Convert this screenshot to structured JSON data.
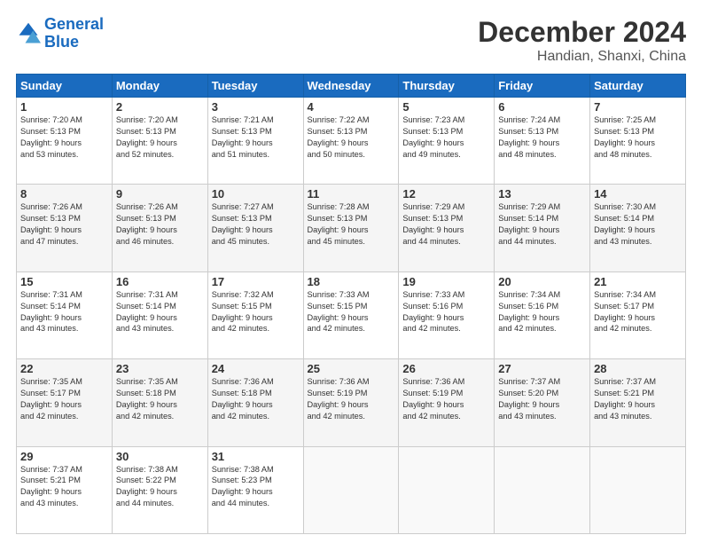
{
  "header": {
    "logo_general": "General",
    "logo_blue": "Blue",
    "main_title": "December 2024",
    "subtitle": "Handian, Shanxi, China"
  },
  "weekdays": [
    "Sunday",
    "Monday",
    "Tuesday",
    "Wednesday",
    "Thursday",
    "Friday",
    "Saturday"
  ],
  "weeks": [
    [
      {
        "day": "1",
        "info": "Sunrise: 7:20 AM\nSunset: 5:13 PM\nDaylight: 9 hours\nand 53 minutes."
      },
      {
        "day": "2",
        "info": "Sunrise: 7:20 AM\nSunset: 5:13 PM\nDaylight: 9 hours\nand 52 minutes."
      },
      {
        "day": "3",
        "info": "Sunrise: 7:21 AM\nSunset: 5:13 PM\nDaylight: 9 hours\nand 51 minutes."
      },
      {
        "day": "4",
        "info": "Sunrise: 7:22 AM\nSunset: 5:13 PM\nDaylight: 9 hours\nand 50 minutes."
      },
      {
        "day": "5",
        "info": "Sunrise: 7:23 AM\nSunset: 5:13 PM\nDaylight: 9 hours\nand 49 minutes."
      },
      {
        "day": "6",
        "info": "Sunrise: 7:24 AM\nSunset: 5:13 PM\nDaylight: 9 hours\nand 48 minutes."
      },
      {
        "day": "7",
        "info": "Sunrise: 7:25 AM\nSunset: 5:13 PM\nDaylight: 9 hours\nand 48 minutes."
      }
    ],
    [
      {
        "day": "8",
        "info": "Sunrise: 7:26 AM\nSunset: 5:13 PM\nDaylight: 9 hours\nand 47 minutes."
      },
      {
        "day": "9",
        "info": "Sunrise: 7:26 AM\nSunset: 5:13 PM\nDaylight: 9 hours\nand 46 minutes."
      },
      {
        "day": "10",
        "info": "Sunrise: 7:27 AM\nSunset: 5:13 PM\nDaylight: 9 hours\nand 45 minutes."
      },
      {
        "day": "11",
        "info": "Sunrise: 7:28 AM\nSunset: 5:13 PM\nDaylight: 9 hours\nand 45 minutes."
      },
      {
        "day": "12",
        "info": "Sunrise: 7:29 AM\nSunset: 5:13 PM\nDaylight: 9 hours\nand 44 minutes."
      },
      {
        "day": "13",
        "info": "Sunrise: 7:29 AM\nSunset: 5:14 PM\nDaylight: 9 hours\nand 44 minutes."
      },
      {
        "day": "14",
        "info": "Sunrise: 7:30 AM\nSunset: 5:14 PM\nDaylight: 9 hours\nand 43 minutes."
      }
    ],
    [
      {
        "day": "15",
        "info": "Sunrise: 7:31 AM\nSunset: 5:14 PM\nDaylight: 9 hours\nand 43 minutes."
      },
      {
        "day": "16",
        "info": "Sunrise: 7:31 AM\nSunset: 5:14 PM\nDaylight: 9 hours\nand 43 minutes."
      },
      {
        "day": "17",
        "info": "Sunrise: 7:32 AM\nSunset: 5:15 PM\nDaylight: 9 hours\nand 42 minutes."
      },
      {
        "day": "18",
        "info": "Sunrise: 7:33 AM\nSunset: 5:15 PM\nDaylight: 9 hours\nand 42 minutes."
      },
      {
        "day": "19",
        "info": "Sunrise: 7:33 AM\nSunset: 5:16 PM\nDaylight: 9 hours\nand 42 minutes."
      },
      {
        "day": "20",
        "info": "Sunrise: 7:34 AM\nSunset: 5:16 PM\nDaylight: 9 hours\nand 42 minutes."
      },
      {
        "day": "21",
        "info": "Sunrise: 7:34 AM\nSunset: 5:17 PM\nDaylight: 9 hours\nand 42 minutes."
      }
    ],
    [
      {
        "day": "22",
        "info": "Sunrise: 7:35 AM\nSunset: 5:17 PM\nDaylight: 9 hours\nand 42 minutes."
      },
      {
        "day": "23",
        "info": "Sunrise: 7:35 AM\nSunset: 5:18 PM\nDaylight: 9 hours\nand 42 minutes."
      },
      {
        "day": "24",
        "info": "Sunrise: 7:36 AM\nSunset: 5:18 PM\nDaylight: 9 hours\nand 42 minutes."
      },
      {
        "day": "25",
        "info": "Sunrise: 7:36 AM\nSunset: 5:19 PM\nDaylight: 9 hours\nand 42 minutes."
      },
      {
        "day": "26",
        "info": "Sunrise: 7:36 AM\nSunset: 5:19 PM\nDaylight: 9 hours\nand 42 minutes."
      },
      {
        "day": "27",
        "info": "Sunrise: 7:37 AM\nSunset: 5:20 PM\nDaylight: 9 hours\nand 43 minutes."
      },
      {
        "day": "28",
        "info": "Sunrise: 7:37 AM\nSunset: 5:21 PM\nDaylight: 9 hours\nand 43 minutes."
      }
    ],
    [
      {
        "day": "29",
        "info": "Sunrise: 7:37 AM\nSunset: 5:21 PM\nDaylight: 9 hours\nand 43 minutes."
      },
      {
        "day": "30",
        "info": "Sunrise: 7:38 AM\nSunset: 5:22 PM\nDaylight: 9 hours\nand 44 minutes."
      },
      {
        "day": "31",
        "info": "Sunrise: 7:38 AM\nSunset: 5:23 PM\nDaylight: 9 hours\nand 44 minutes."
      },
      null,
      null,
      null,
      null
    ]
  ]
}
